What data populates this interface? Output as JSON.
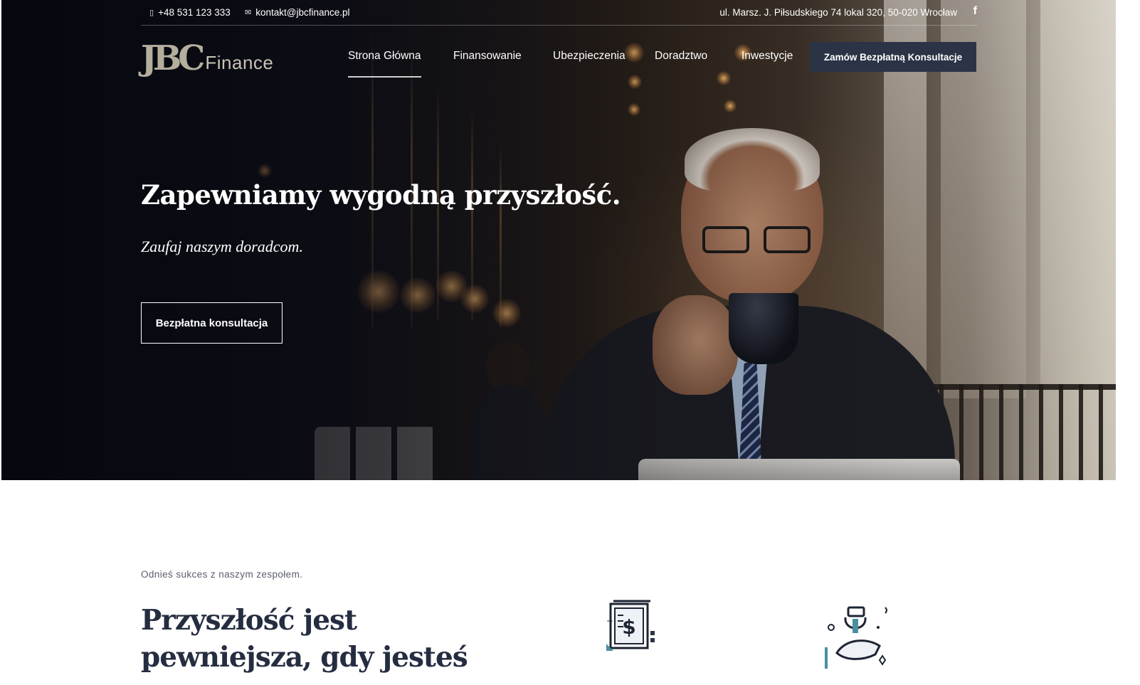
{
  "topbar": {
    "phone": "+48 531 123 333",
    "email": "kontakt@jbcfinance.pl",
    "address": "ul. Marsz. J. Piłsudskiego 74 lokal 320, 50-020 Wrocław",
    "facebook_icon": "f"
  },
  "logo": {
    "mark": "JBC",
    "text": "Finance"
  },
  "nav": {
    "items": [
      {
        "label": "Strona Główna"
      },
      {
        "label": "Finansowanie"
      },
      {
        "label": "Ubezpieczenia"
      },
      {
        "label": "Doradztwo"
      },
      {
        "label": "Inwestycje"
      }
    ],
    "cta": "Zamów Bezpłatną Konsultacje"
  },
  "hero": {
    "title": "Zapewniamy wygodną przyszłość.",
    "subtitle": "Zaufaj naszym doradcom.",
    "button": "Bezpłatna konsultacja"
  },
  "section": {
    "eyebrow": "Odnieś sukces z naszym zespołem.",
    "title": "Przyszłość jest pewniejsza, gdy jesteś"
  },
  "colors": {
    "primary": "#252d40",
    "cta_bg": "#2a3446",
    "logo": "#b4ae9d",
    "accent_teal": "#4a8fa0"
  },
  "icons": [
    "phone-icon",
    "mail-icon",
    "facebook-icon",
    "finance-document-icon",
    "money-hand-icon"
  ]
}
